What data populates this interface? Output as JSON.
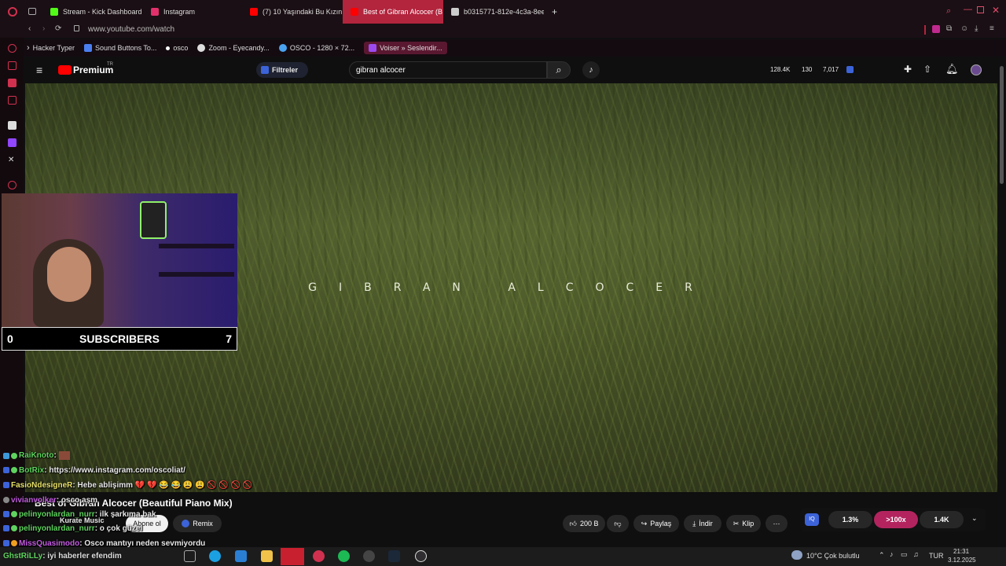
{
  "browser": {
    "tabs": [
      {
        "label": "Stream - Kick Dashboard",
        "color": "#53fc18"
      },
      {
        "label": "Instagram",
        "color": "#e1306c"
      },
      {
        "label": "(7) 10 Yaşındaki Bu Kızın",
        "color": "#ff0000"
      },
      {
        "label": "Best of Gibran Alcocer (B",
        "color": "#ff0000"
      },
      {
        "label": "b0315771-812e-4c3a-8ee",
        "color": "#cccccc"
      }
    ],
    "url": "www.youtube.com/watch",
    "bookmarks": [
      "Hacker Typer",
      "Sound Buttons To...",
      "osco",
      "Zoom - Eyecandy...",
      "OSCO - 1280 × 72...",
      "Voiser » Seslendir..."
    ]
  },
  "youtube": {
    "logo": "Premium",
    "logo_region": "TR",
    "filters_label": "Filtreler",
    "search_value": "gibran alcocer",
    "stats": [
      "128.4K",
      "130",
      "7,017"
    ],
    "video_overlay_text": "GIBRAN ALCOCER",
    "video_title": "Best of Gibran Alcocer (Beautiful Piano Mix)",
    "channel": "Kurate Music",
    "subscribe_label": "Abone ol",
    "remix_label": "Remix",
    "like_count": "200 B",
    "share_label": "Paylaş",
    "download_label": "İndir",
    "clip_label": "Klip",
    "iq_stats": [
      "1.3%",
      ">100x",
      "1.4K"
    ],
    "accent": "#ff0000"
  },
  "overlay": {
    "subscribers_label": "SUBSCRIBERS",
    "left_count": "0",
    "right_count": "7"
  },
  "chat": [
    {
      "user": "RaiKnoto",
      "text": ": ",
      "color": "#5fd35f"
    },
    {
      "user": "BotRix",
      "text": ": https://www.instagram.com/oscoliat/",
      "color": "#5fd35f"
    },
    {
      "user": "FasioNdesigneR",
      "text": ": Hebe ablişimm 💔 💔 😂 😂 😩 😩 🚫 🚫 🚫 🚫",
      "color": "#e8e26a"
    },
    {
      "user": "vivianvolker",
      "text": ": osco aşm",
      "color": "#c25be0"
    },
    {
      "user": "pelinyonlardan_nurr",
      "text": ": ilk şarkıma bak",
      "color": "#5fd35f"
    },
    {
      "user": "pelinyonlardan_nurr",
      "text": ": o çok güzel",
      "color": "#5fd35f"
    },
    {
      "user": "MissQuasimodo",
      "text": ": Osco mantıyı neden sevmiyordu",
      "color": "#c25be0"
    },
    {
      "user": "GhstRiLLy",
      "text": ": iyi haberler efendim",
      "color": "#5fd35f"
    }
  ],
  "taskbar": {
    "weather": "10°C  Çok bulutlu",
    "lang": "TUR",
    "time": "21:31",
    "date": "3.12.2025"
  }
}
